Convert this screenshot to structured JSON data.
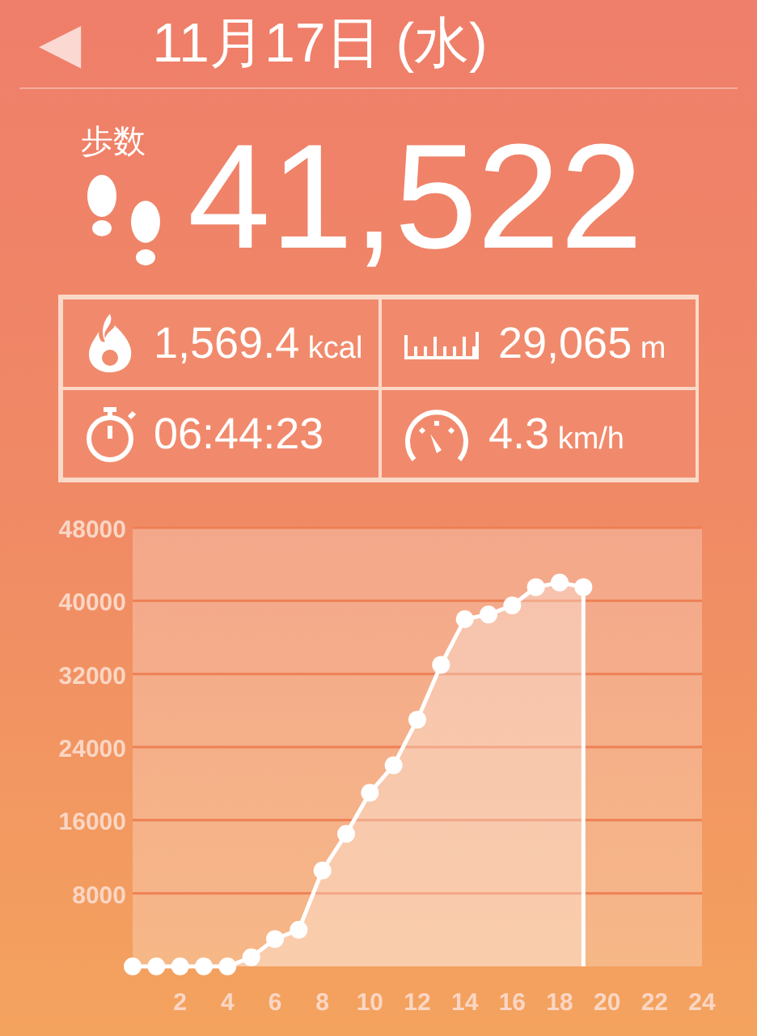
{
  "header": {
    "back": "◀",
    "date": "11月17日 (水)"
  },
  "steps": {
    "label": "歩数",
    "value": "41,522"
  },
  "stats": [
    {
      "kind": "calories",
      "value": "1,569.4",
      "unit": "kcal"
    },
    {
      "kind": "distance",
      "value": "29,065",
      "unit": "m"
    },
    {
      "kind": "time",
      "value": "06:44:23"
    },
    {
      "kind": "speed",
      "value": "4.3",
      "unit": "km/h"
    }
  ],
  "chart_data": {
    "type": "area",
    "grid": true,
    "xlim": [
      0,
      24
    ],
    "ylim": [
      0,
      48000
    ],
    "xticks": [
      2,
      4,
      6,
      8,
      10,
      12,
      14,
      16,
      18,
      20,
      22,
      24
    ],
    "yticks": [
      8000,
      16000,
      24000,
      32000,
      40000,
      48000
    ],
    "x": [
      0,
      1,
      2,
      3,
      4,
      5,
      6,
      7,
      8,
      9,
      10,
      11,
      12,
      13,
      14,
      15,
      16,
      17,
      18,
      19
    ],
    "series": [
      {
        "color": "#ffffff",
        "marker": true,
        "values": [
          0,
          0,
          0,
          0,
          0,
          1000,
          3000,
          4000,
          10500,
          14500,
          19000,
          22000,
          27000,
          33000,
          38000,
          38500,
          39500,
          41500,
          42000,
          41500
        ]
      }
    ]
  }
}
